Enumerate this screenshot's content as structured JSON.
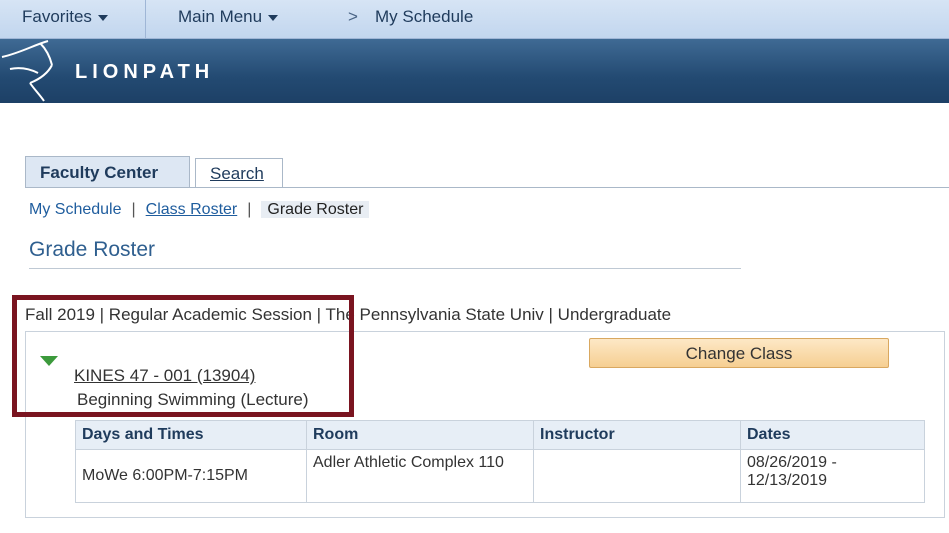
{
  "topnav": {
    "favorites": "Favorites",
    "main_menu": "Main Menu",
    "breadcrumb_arrow": ">",
    "breadcrumb_current": "My Schedule"
  },
  "banner": {
    "brand": "LIONPATH"
  },
  "tabs": [
    {
      "label": "Faculty Center",
      "active": true
    },
    {
      "label": "Search",
      "active": false
    }
  ],
  "subnav": {
    "items": [
      "My Schedule",
      "Class Roster",
      "Grade Roster"
    ],
    "separator": "|"
  },
  "page": {
    "title": "Grade Roster",
    "context": "Fall 2019 | Regular Academic Session | The Pennsylvania State Univ | Undergraduate"
  },
  "class": {
    "link": "KINES 47 - 001 (13904)",
    "description": "Beginning Swimming (Lecture)",
    "change_button": "Change Class"
  },
  "meeting_table": {
    "headers": [
      "Days and Times",
      "Room",
      "Instructor",
      "Dates"
    ],
    "rows": [
      [
        "MoWe 6:00PM-7:15PM",
        "Adler Athletic Complex 110",
        "",
        "08/26/2019 - 12/13/2019"
      ]
    ]
  },
  "colors": {
    "highlight_border": "#7a1420",
    "banner": "#234a72",
    "button": "#f6cf92",
    "triangle": "#3c9a3c"
  }
}
